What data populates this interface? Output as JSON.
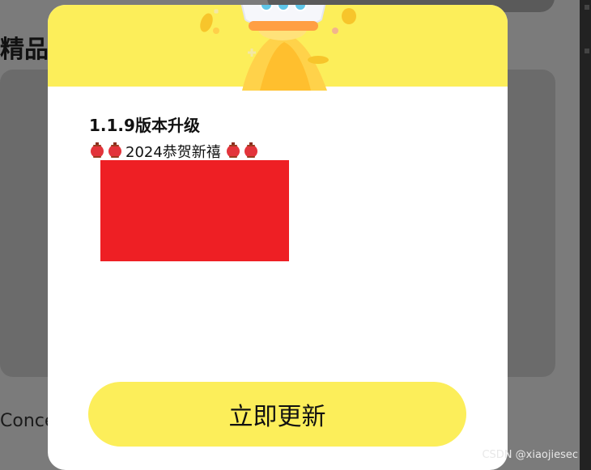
{
  "background": {
    "section_title": "精品",
    "bottom_text": "Conce"
  },
  "dialog": {
    "version_title": "1.1.9版本升级",
    "greeting": {
      "text": "2024恭贺新禧",
      "left_icons": [
        "lantern-icon",
        "lantern-icon"
      ],
      "right_icons": [
        "lantern-icon",
        "lantern-icon"
      ]
    },
    "update_button_label": "立即更新"
  },
  "watermark": "CSDN @xiaojiesec",
  "colors": {
    "accent_yellow": "#fcee5a",
    "redaction_red": "#ee1f24",
    "overlay_gray": "#7b7b7b"
  }
}
